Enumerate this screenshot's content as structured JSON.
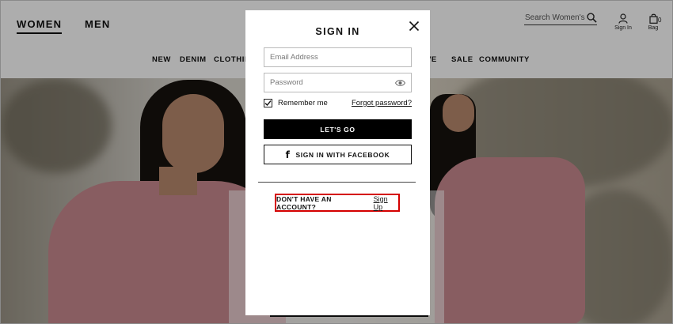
{
  "header": {
    "women_label": "WOMEN",
    "men_label": "MEN",
    "search_placeholder": "Search Women's",
    "signin_label": "Sign In",
    "bag_label": "Bag",
    "bag_count": "0",
    "nav": [
      "NEW",
      "DENIM",
      "CLOTHING",
      "VE",
      "SALE",
      "COMMUNITY"
    ]
  },
  "modal": {
    "title": "SIGN IN",
    "email_placeholder": "Email Address",
    "password_placeholder": "Password",
    "remember_label": "Remember me",
    "remember_checked": true,
    "forgot_label": "Forgot password?",
    "primary_button": "LET'S GO",
    "facebook_button": "SIGN IN WITH FACEBOOK",
    "signup_question": "DON'T HAVE AN ACCOUNT?",
    "signup_link": "Sign Up"
  },
  "colors": {
    "highlight": "#d40000",
    "primary_button_bg": "#000000",
    "overlay": "rgba(0,0,0,0.32)"
  },
  "icons": {
    "search": "search-icon",
    "user": "user-icon",
    "bag": "bag-icon",
    "close": "close-icon",
    "eye": "eye-icon",
    "check": "check-icon",
    "facebook": "facebook-icon"
  }
}
